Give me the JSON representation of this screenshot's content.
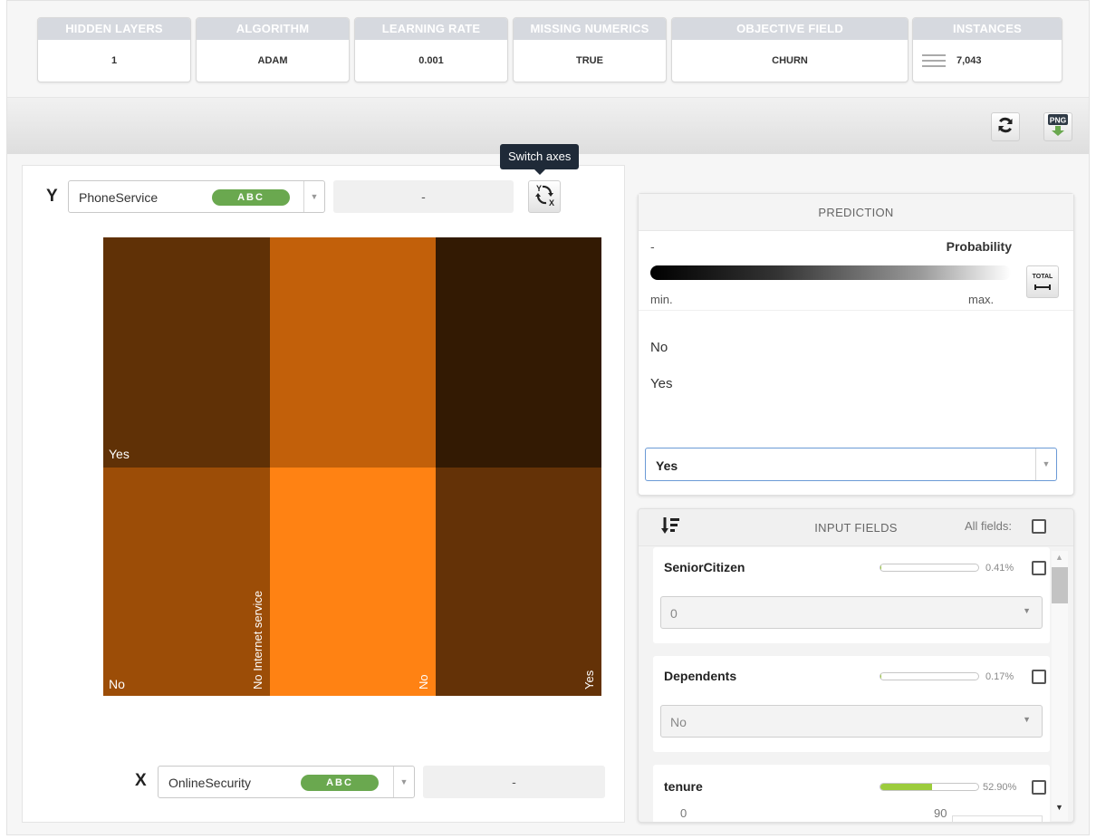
{
  "summary": {
    "cards": [
      {
        "header": "HIDDEN LAYERS",
        "value": "1"
      },
      {
        "header": "ALGORITHM",
        "value": "ADAM"
      },
      {
        "header": "LEARNING RATE",
        "value": "0.001"
      },
      {
        "header": "MISSING NUMERICS",
        "value": "TRUE"
      },
      {
        "header": "OBJECTIVE FIELD",
        "value": "CHURN"
      },
      {
        "header": "INSTANCES",
        "value": "7,043"
      }
    ]
  },
  "toolbar": {
    "refresh_icon": "refresh-icon",
    "png_icon": "png-download-icon",
    "png_label": "PNG"
  },
  "y_axis": {
    "letter": "Y",
    "field": "PhoneService",
    "type_badge": "ABC",
    "value": "-"
  },
  "x_axis": {
    "letter": "X",
    "field": "OnlineSecurity",
    "type_badge": "ABC",
    "value": "-"
  },
  "switch_axes": {
    "tooltip": "Switch axes",
    "icon": "switch-axes-icon"
  },
  "heatmap": {
    "row_labels": [
      "Yes",
      "No"
    ],
    "col_labels": [
      "No Internet service",
      "No",
      "Yes"
    ],
    "colors": [
      [
        "#603106",
        "#c2600a",
        "#331a03"
      ],
      [
        "#9c4d07",
        "#ff8213",
        "#643207"
      ]
    ]
  },
  "prediction": {
    "header": "PREDICTION",
    "dash": "-",
    "probability_label": "Probability",
    "min_label": "min.",
    "max_label": "max.",
    "total_label": "TOTAL",
    "classes": [
      "No",
      "Yes"
    ],
    "selected_class": "Yes"
  },
  "input_fields": {
    "header": "INPUT FIELDS",
    "all_fields_label": "All fields:",
    "sort_icon": "sort-icon",
    "fields": [
      {
        "name": "SeniorCitizen",
        "importance": 0.0041,
        "pct_label": "0.41%",
        "value": "0"
      },
      {
        "name": "Dependents",
        "importance": 0.0017,
        "pct_label": "0.17%",
        "value": "No"
      },
      {
        "name": "tenure",
        "importance": 0.529,
        "pct_label": "52.90%",
        "range_min": "0",
        "range_max": "90"
      }
    ]
  }
}
